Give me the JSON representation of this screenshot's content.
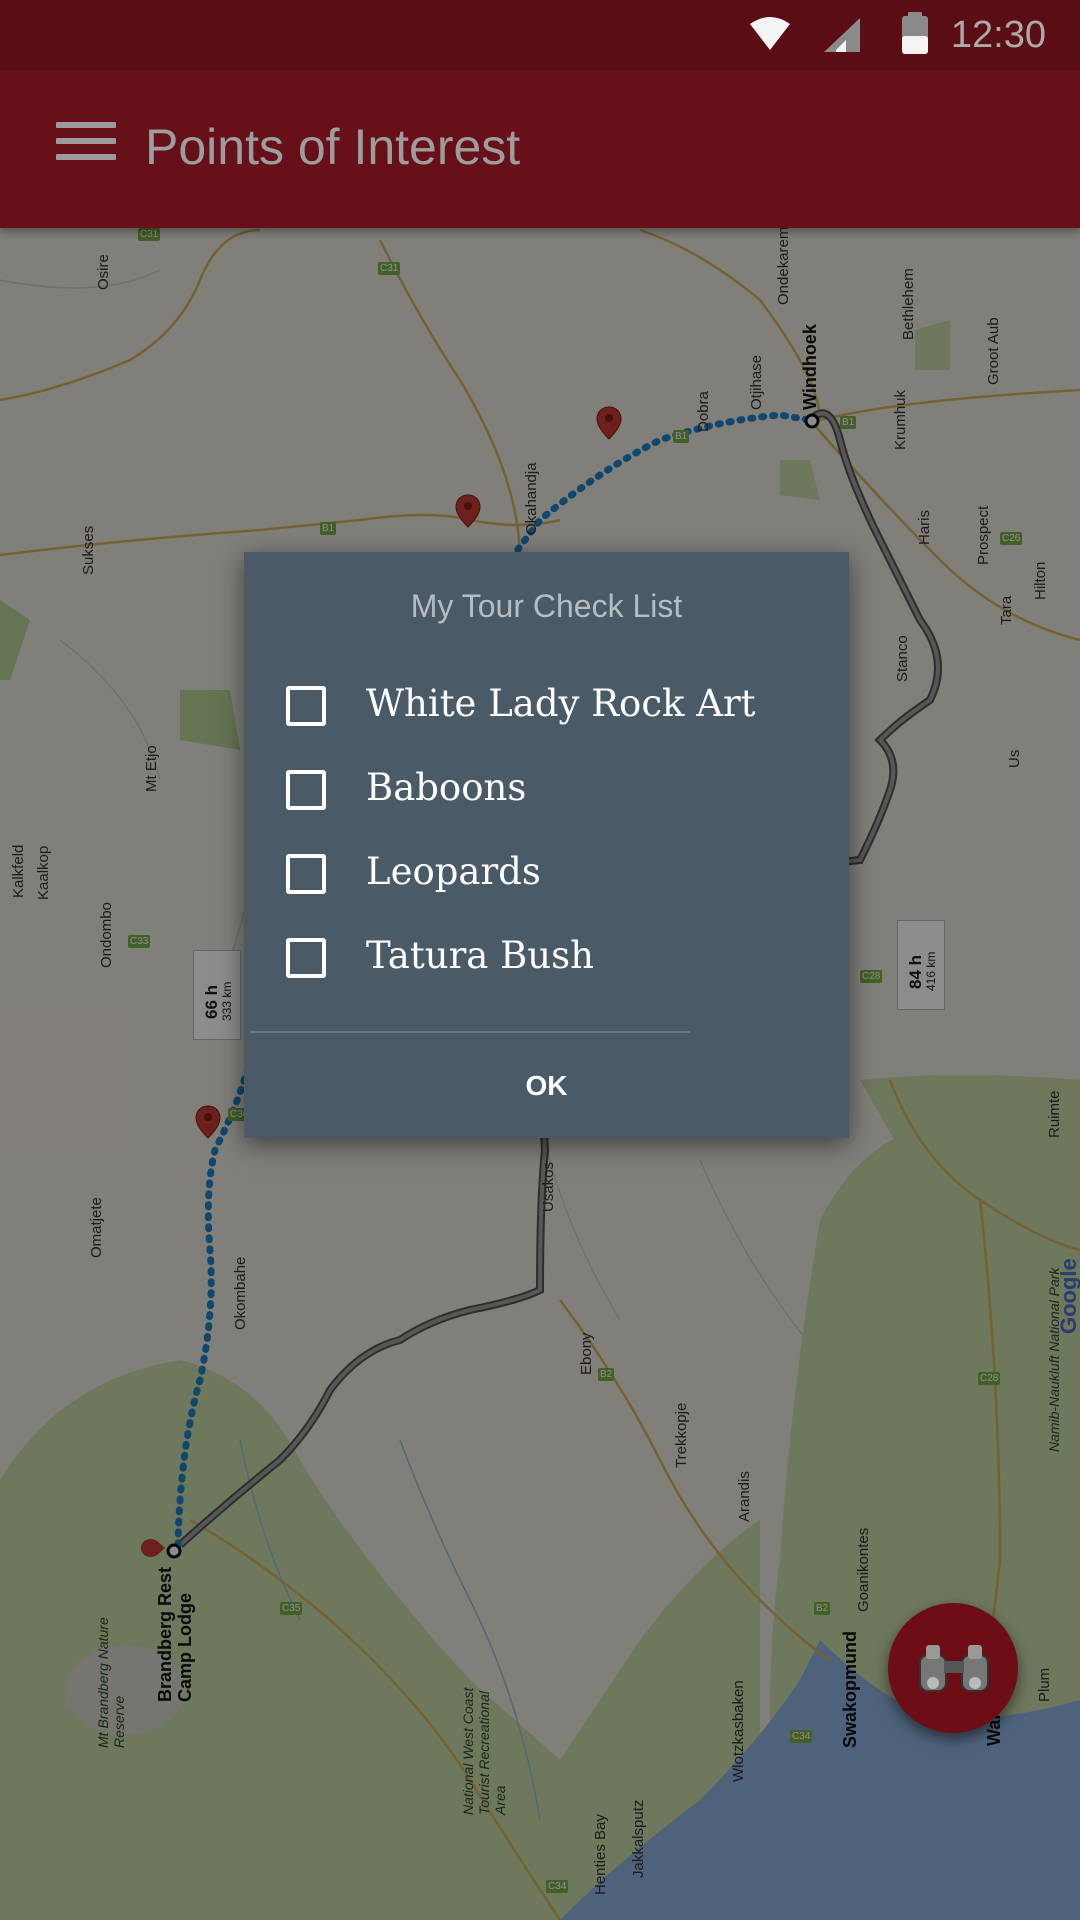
{
  "status_bar": {
    "time": "12:30",
    "icons": [
      "wifi-icon",
      "cellular-signal-icon",
      "battery-icon"
    ]
  },
  "app_bar": {
    "menu_icon": "hamburger-menu-icon",
    "title": "Points of Interest",
    "color": "#681019"
  },
  "map": {
    "labels": [
      "Osire",
      "Ondekaremba",
      "Windhoek",
      "Bethlehem",
      "Groot Aub",
      "Otjihase",
      "Dobra",
      "Okahandja",
      "Krumhuk",
      "Sukses",
      "Haris",
      "Prospect",
      "Hilton",
      "Tara",
      "Stanco",
      "Us",
      "Mt Etjo",
      "Kalkfeld",
      "Kaalkop",
      "Ondombo",
      "Omatjete",
      "Okombahe",
      "Usakos",
      "Ebony",
      "Trekkopje",
      "Arandis",
      "Goanikontes",
      "Swakopmund",
      "Walvis",
      "Plum",
      "Ruimte",
      "Namib-Naukluft National Park",
      "Brandberg Rest Camp Lodge",
      "Mt Brandberg Nature Reserve",
      "National West Coast Tourist Recreational Area",
      "Henties Bay",
      "Jakkalsputz",
      "Wlotzkasbaken",
      "Google"
    ],
    "road_shields": [
      "C31",
      "C31",
      "B1",
      "B1",
      "B1",
      "C26",
      "C33",
      "C36",
      "C28",
      "B2",
      "C28",
      "C35",
      "C34",
      "C34",
      "B2"
    ],
    "route_boxes": [
      {
        "time": "66 h",
        "distance": "333 km"
      },
      {
        "time": "84 h",
        "distance": "416 km"
      }
    ],
    "route_color": "#1d82c8"
  },
  "dialog": {
    "title": "My Tour Check List",
    "items": [
      {
        "label": "White Lady Rock Art",
        "checked": false
      },
      {
        "label": "Baboons",
        "checked": false
      },
      {
        "label": "Leopards",
        "checked": false
      },
      {
        "label": "Tatura Bush",
        "checked": false
      }
    ],
    "ok_label": "OK",
    "background": "#4a5b67"
  },
  "fab": {
    "icon": "binoculars-icon",
    "color": "#6e0d16"
  }
}
